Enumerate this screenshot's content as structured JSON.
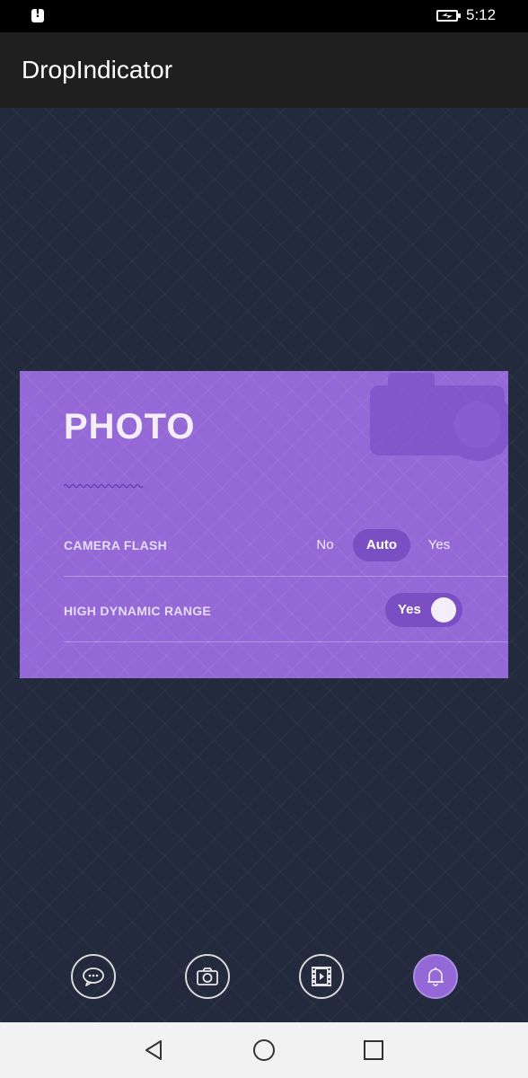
{
  "status_bar": {
    "time": "5:12",
    "icons": [
      "alert-icon",
      "battery-charging-icon"
    ]
  },
  "app_bar": {
    "title": "DropIndicator"
  },
  "card": {
    "title": "PHOTO",
    "background_icon": "camera-icon",
    "camera_flash": {
      "label": "CAMERA FLASH",
      "options": [
        "No",
        "Auto",
        "Yes"
      ],
      "selected": "Auto"
    },
    "hdr": {
      "label": "HIGH DYNAMIC RANGE",
      "toggle_label": "Yes",
      "value": true
    }
  },
  "bottom_tabs": [
    {
      "name": "chat",
      "icon": "chat-bubble-icon",
      "active": false
    },
    {
      "name": "photo",
      "icon": "camera-icon",
      "active": false
    },
    {
      "name": "video",
      "icon": "film-icon",
      "active": false
    },
    {
      "name": "notifications",
      "icon": "bell-icon",
      "active": true
    }
  ],
  "nav_bar": {
    "buttons": [
      "back-icon",
      "home-icon",
      "recents-icon"
    ]
  },
  "colors": {
    "card_background": "#9468d6",
    "selected_pill": "#7b4fc4",
    "app_bar": "#1f1f1f",
    "page_background": "#232a3d"
  }
}
